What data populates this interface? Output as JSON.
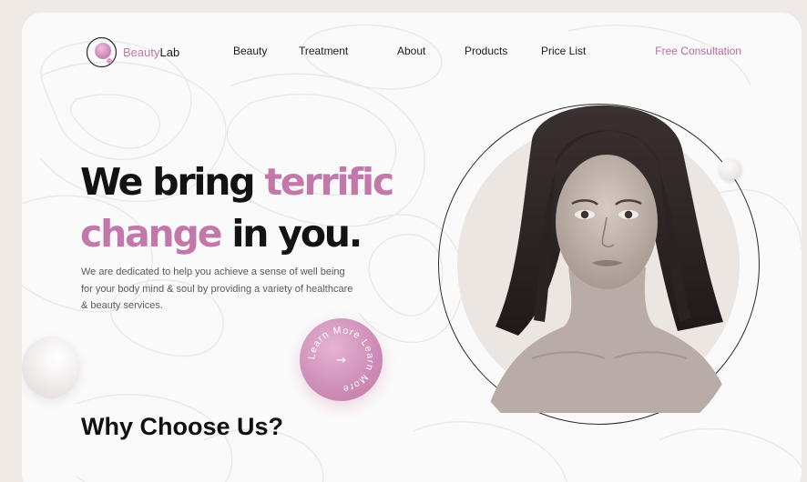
{
  "brand": {
    "name_part1": "Beauty",
    "name_part2": "Lab",
    "accent_color": "#c27aa8"
  },
  "nav": {
    "items": [
      {
        "label": "Beauty"
      },
      {
        "label": "Treatment"
      },
      {
        "label": "About"
      },
      {
        "label": "Products"
      },
      {
        "label": "Price List"
      }
    ],
    "cta_label": "Free Consultation"
  },
  "hero": {
    "title_line1_a": "We bring ",
    "title_line1_b": "terrific",
    "title_line2_a": "change",
    "title_line2_b": " in you.",
    "description": "We are dedicated to help you achieve a sense of well being for your body mind & soul by providing a variety of healthcare & beauty services.",
    "learn_more_text": "Learn More Learn More",
    "learn_more_arrow": "→"
  },
  "sections": {
    "why_title": "Why Choose Us?"
  },
  "colors": {
    "pink": "#c279aa",
    "background": "#efe9e6",
    "card": "#fbfafa",
    "text_dark": "#131313"
  }
}
